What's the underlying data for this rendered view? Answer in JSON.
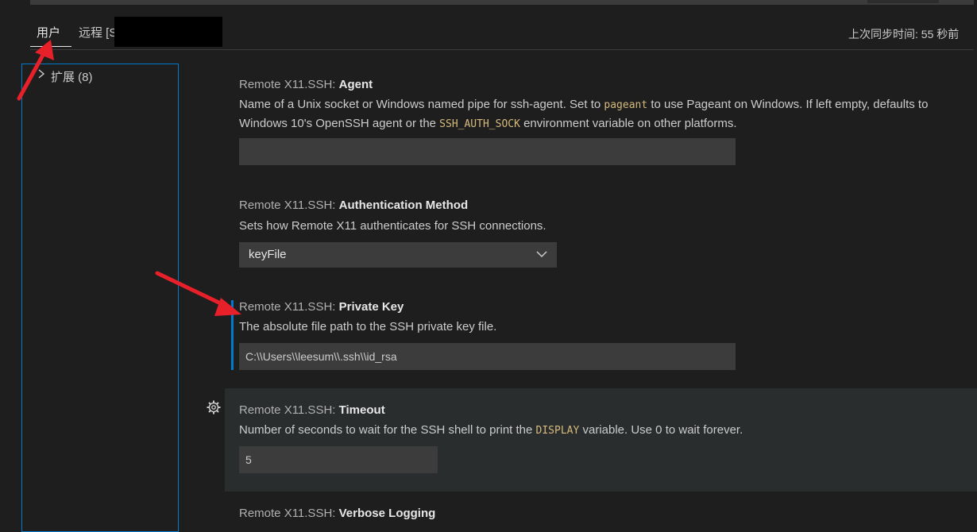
{
  "tabs": {
    "user": "用户",
    "remote": "远程 [S"
  },
  "sync_status": "上次同步时间: 55 秒前",
  "toc": {
    "item_label": "扩展 (8)"
  },
  "settings": [
    {
      "prefix": "Remote X11.SSH: ",
      "name": "Agent",
      "desc_1": "Name of a Unix socket or Windows named pipe for ssh-agent. Set to ",
      "code_1": "pageant",
      "desc_2": " to use Pageant on Windows. If left empty, defaults to Windows 10's OpenSSH agent or the ",
      "code_2": "SSH_AUTH_SOCK",
      "desc_3": " environment variable on other platforms.",
      "value": ""
    },
    {
      "prefix": "Remote X11.SSH: ",
      "name": "Authentication Method",
      "desc": "Sets how Remote X11 authenticates for SSH connections.",
      "value": "keyFile"
    },
    {
      "prefix": "Remote X11.SSH: ",
      "name": "Private Key",
      "desc": "The absolute file path to the SSH private key file.",
      "value": "C:\\\\Users\\\\leesum\\\\.ssh\\\\id_rsa"
    },
    {
      "prefix": "Remote X11.SSH: ",
      "name": "Timeout",
      "desc_1": "Number of seconds to wait for the SSH shell to print the ",
      "code_1": "DISPLAY",
      "desc_2": " variable. Use 0 to wait forever.",
      "value": "5"
    },
    {
      "prefix": "Remote X11.SSH: ",
      "name": "Verbose Logging"
    }
  ],
  "icons": {
    "toc_expand": "chevron-right-icon",
    "select_dropdown": "chevron-down-icon",
    "setting_gear": "gear-icon"
  },
  "colors": {
    "background": "#1e1e1e",
    "accent": "#007acc",
    "code": "#d7ba7d",
    "annotation_arrow": "#e8202a"
  }
}
